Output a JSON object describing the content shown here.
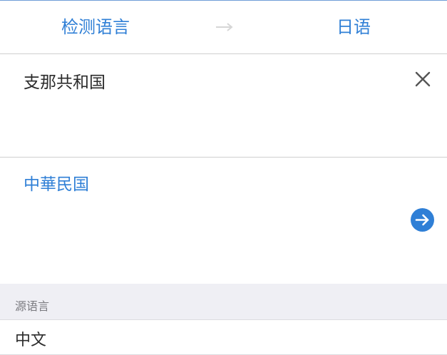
{
  "language_bar": {
    "source_label": "检测语言",
    "target_label": "日语",
    "arrow_icon": "right-arrow-icon",
    "accent_color": "#2f7fd6"
  },
  "input": {
    "text": "支那共和国",
    "clear_icon": "close-icon"
  },
  "result": {
    "text": "中華民国",
    "go_icon": "arrow-circle-right-icon"
  },
  "source_language_section": {
    "header": "源语言",
    "value": "中文"
  }
}
